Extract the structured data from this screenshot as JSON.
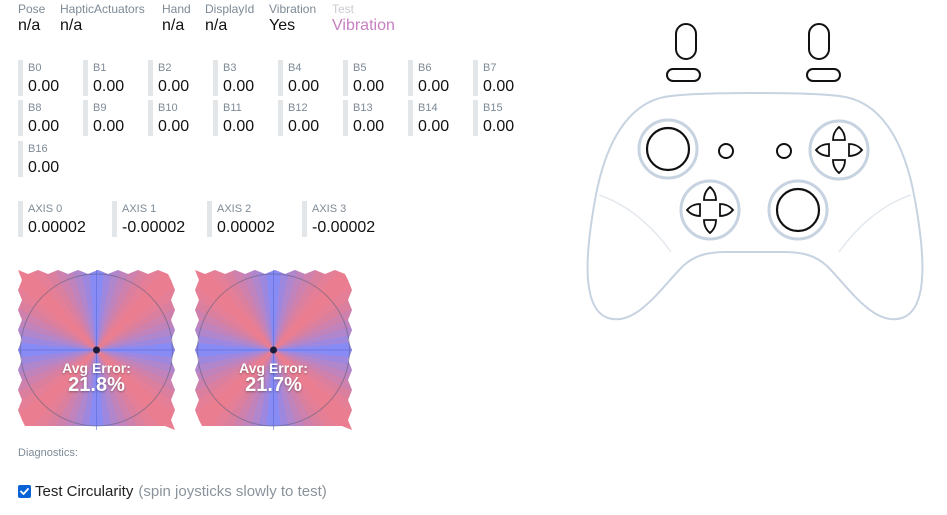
{
  "info": [
    {
      "label": "Pose",
      "value": "n/a"
    },
    {
      "label": "HapticActuators",
      "value": "n/a"
    },
    {
      "label": "Hand",
      "value": "n/a"
    },
    {
      "label": "DisplayId",
      "value": "n/a"
    },
    {
      "label": "Vibration",
      "value": "Yes"
    },
    {
      "label": "Test",
      "value": "Vibration"
    }
  ],
  "buttons": [
    {
      "label": "B0",
      "value": "0.00"
    },
    {
      "label": "B1",
      "value": "0.00"
    },
    {
      "label": "B2",
      "value": "0.00"
    },
    {
      "label": "B3",
      "value": "0.00"
    },
    {
      "label": "B4",
      "value": "0.00"
    },
    {
      "label": "B5",
      "value": "0.00"
    },
    {
      "label": "B6",
      "value": "0.00"
    },
    {
      "label": "B7",
      "value": "0.00"
    },
    {
      "label": "B8",
      "value": "0.00"
    },
    {
      "label": "B9",
      "value": "0.00"
    },
    {
      "label": "B10",
      "value": "0.00"
    },
    {
      "label": "B11",
      "value": "0.00"
    },
    {
      "label": "B12",
      "value": "0.00"
    },
    {
      "label": "B13",
      "value": "0.00"
    },
    {
      "label": "B14",
      "value": "0.00"
    },
    {
      "label": "B15",
      "value": "0.00"
    },
    {
      "label": "B16",
      "value": "0.00"
    }
  ],
  "axes": [
    {
      "label": "AXIS 0",
      "value": "0.00002"
    },
    {
      "label": "AXIS 1",
      "value": "-0.00002"
    },
    {
      "label": "AXIS 2",
      "value": "0.00002"
    },
    {
      "label": "AXIS 3",
      "value": "-0.00002"
    }
  ],
  "sticks": [
    {
      "error_label": "Avg Error:",
      "error_value": "21.8%"
    },
    {
      "error_label": "Avg Error:",
      "error_value": "21.7%"
    }
  ],
  "colors": {
    "error_red": "#ff7b7b",
    "ok_blue": "#7f8cff",
    "test_purple": "#c77fc0",
    "controller_outline": "#c7d3e1",
    "checkbox_blue": "#0a63d6"
  },
  "diagnostics": {
    "title": "Diagnostics:"
  },
  "circularity": {
    "label": "Test Circularity",
    "hint": "(spin joysticks slowly to test)",
    "checked": true
  }
}
